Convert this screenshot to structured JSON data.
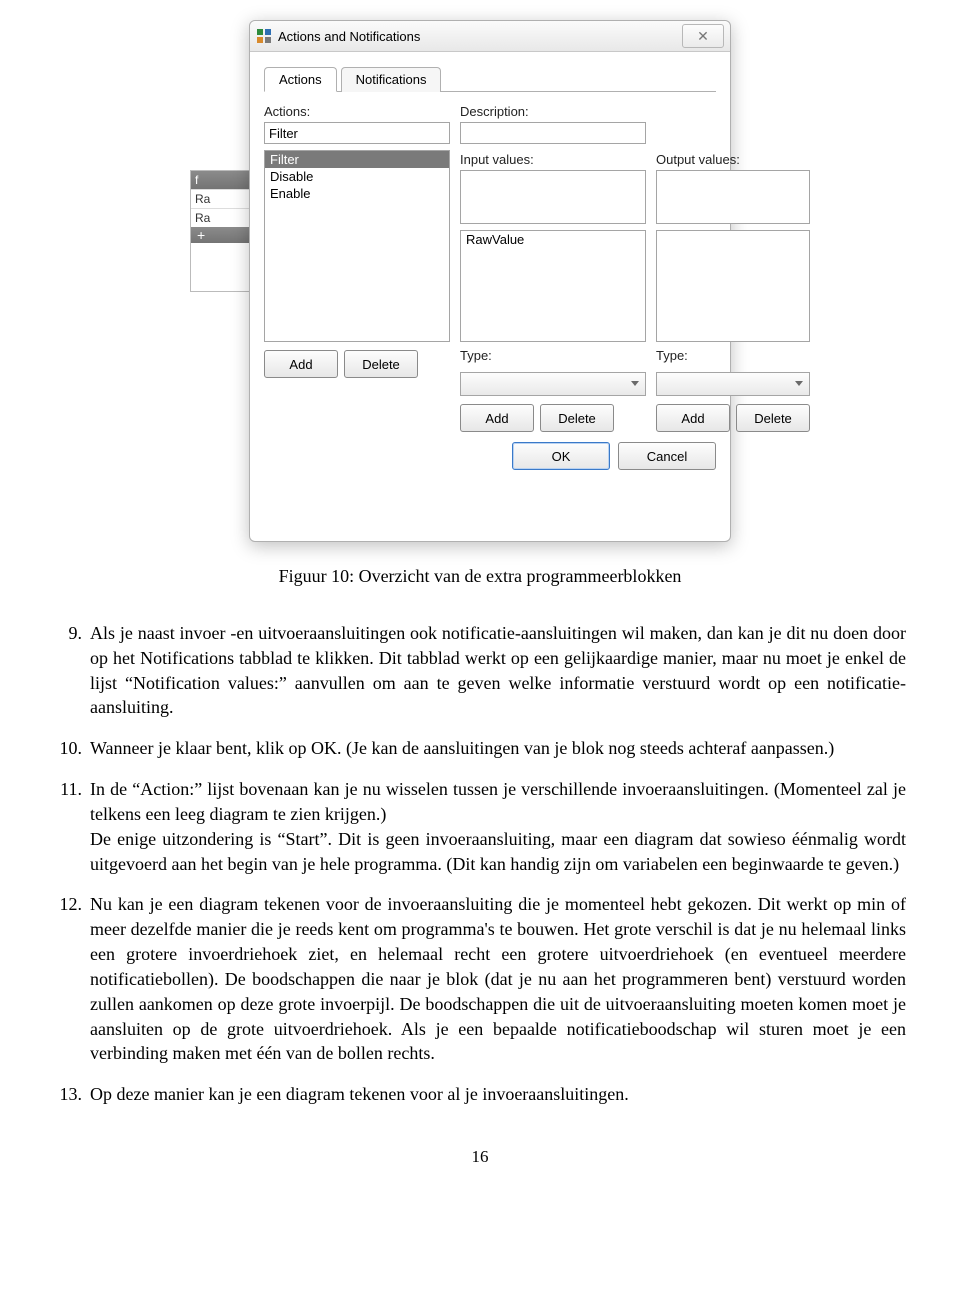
{
  "dialog": {
    "title": "Actions and Notifications",
    "tabs": [
      "Actions",
      "Notifications"
    ],
    "labels": {
      "actions": "Actions:",
      "description": "Description:",
      "input_values": "Input values:",
      "output_values": "Output values:",
      "type_left": "Type:",
      "type_right": "Type:"
    },
    "actions_filter_value": "Filter",
    "actions_list": [
      "Filter",
      "Disable",
      "Enable"
    ],
    "input_values_list": [
      "RawValue"
    ],
    "buttons": {
      "add": "Add",
      "delete": "Delete",
      "ok": "OK",
      "cancel": "Cancel"
    }
  },
  "bg_panel": {
    "header": "f",
    "row1": "Ra",
    "row2": "Ra",
    "plus": "+"
  },
  "caption": "Figuur 10: Overzicht van de extra programmeerblokken",
  "items": {
    "n9": "9.",
    "p9": "Als je naast invoer -en uitvoeraansluitingen ook notificatie-aansluitingen wil maken, dan kan je dit nu doen door op het Notifications tabblad te klikken. Dit tabblad werkt op een gelijkaardige manier, maar nu moet je enkel de lijst “Notification values:” aanvullen om aan te geven welke informatie verstuurd wordt op een notificatie-aansluiting.",
    "n10": "10.",
    "p10": "Wanneer je klaar bent, klik op OK. (Je kan de aansluitingen van je blok nog steeds achteraf aanpassen.)",
    "n11": "11.",
    "p11": "In de “Action:” lijst bovenaan kan je nu wisselen tussen je verschillende invoeraansluitingen. (Momenteel zal je telkens een leeg diagram te zien krijgen.)\nDe enige uitzondering is “Start”. Dit is geen invoeraansluiting, maar een diagram dat sowieso éénmalig wordt uitgevoerd aan het begin van je hele programma. (Dit kan handig zijn om variabelen een beginwaarde te geven.)",
    "n12": "12.",
    "p12": "Nu kan je een diagram tekenen voor de invoeraansluiting die je momenteel hebt gekozen. Dit werkt op min of meer dezelfde manier die je reeds kent om programma's te bouwen. Het grote verschil is dat je nu helemaal links een grotere invoerdriehoek ziet, en helemaal recht een grotere uitvoerdriehoek (en eventueel meerdere notificatiebollen). De boodschappen die naar je blok (dat je nu aan het programmeren bent) verstuurd worden zullen aankomen op deze grote invoerpijl. De boodschappen die uit de uitvoeraansluiting moeten komen moet je aansluiten op de grote uitvoerdriehoek. Als je een bepaalde notificatieboodschap wil sturen moet je een verbinding maken met één van de bollen rechts.",
    "n13": "13.",
    "p13": "Op deze manier kan je een diagram tekenen voor al je invoeraansluitingen."
  },
  "page_number": "16"
}
